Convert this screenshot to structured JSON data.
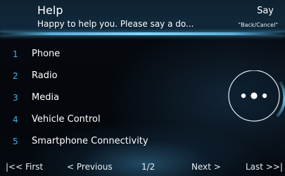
{
  "header": {
    "title": "Help",
    "subtitle": "Happy to help you. Please say a do...",
    "say_label": "Say",
    "say_hint": "\"Back/Cancel\""
  },
  "menu": {
    "items": [
      {
        "number": "1",
        "label": "Phone"
      },
      {
        "number": "2",
        "label": "Radio"
      },
      {
        "number": "3",
        "label": "Media"
      },
      {
        "number": "4",
        "label": "Vehicle Control"
      },
      {
        "number": "5",
        "label": "Smartphone Connectivity"
      }
    ]
  },
  "voice_indicator": {
    "icon": "voice-listening-dots-icon"
  },
  "pagination": {
    "first_label": "|<< First",
    "prev_label": "< Previous",
    "page_indicator": "1/2",
    "next_label": "Next >",
    "last_label": "Last >>|"
  },
  "colors": {
    "accent": "#3fb4ea",
    "header_bg": "#10283a",
    "background": "#05090e",
    "text": "#ffffff"
  }
}
